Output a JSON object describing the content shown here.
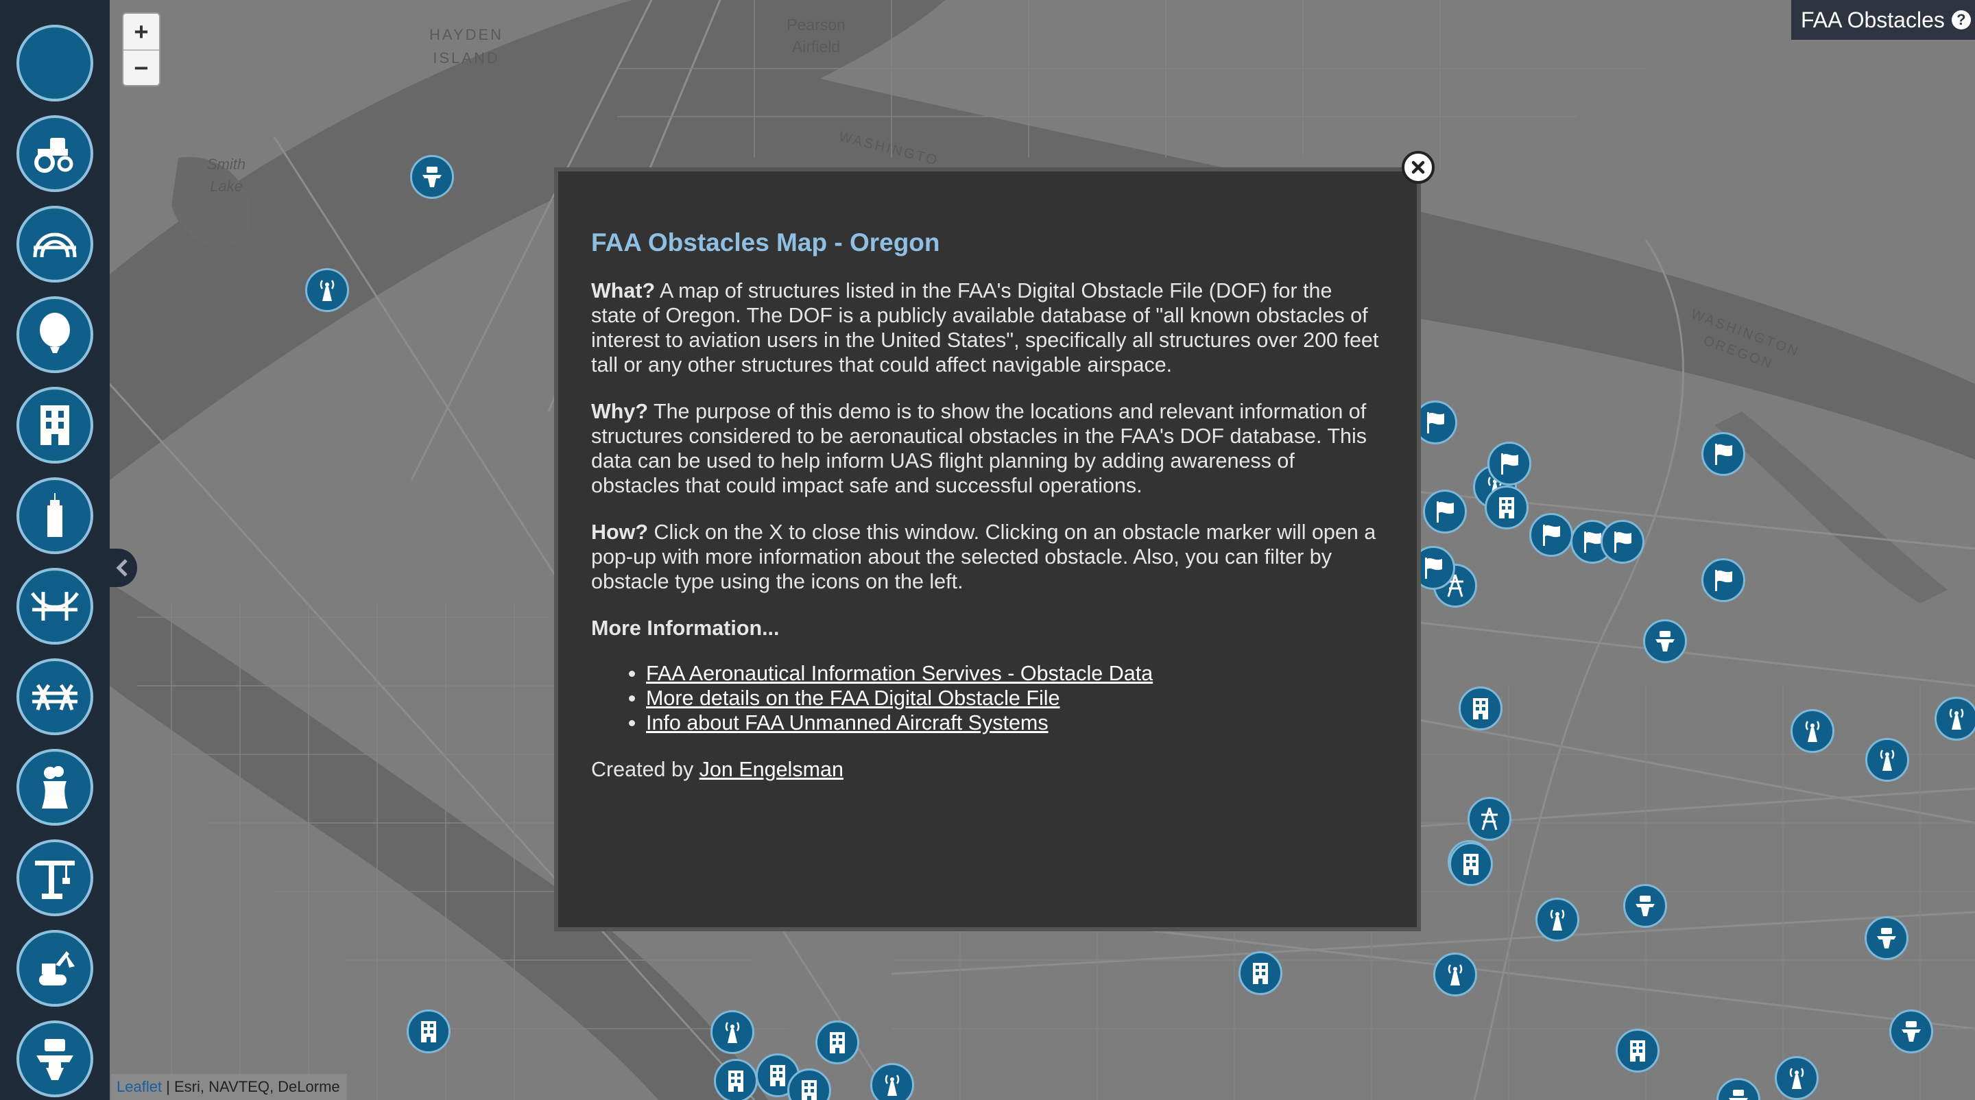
{
  "app": {
    "title": "FAA Obstacles",
    "help_icon": "question-circle-icon"
  },
  "zoom": {
    "in_label": "+",
    "out_label": "−"
  },
  "attribution": {
    "leaflet": "Leaflet",
    "sources": " | Esri, NAVTEQ, DeLorme"
  },
  "map_labels": {
    "hayden": "HAYDEN\nISLAND",
    "pearson": "Pearson\nAirfield",
    "smith": "Smith\nLake",
    "washington_road": "WASHINGTO",
    "state_line": "WASHINGTON\nOREGON"
  },
  "sidebar": {
    "filters": [
      {
        "name": "all-filter",
        "icon": "circle-icon"
      },
      {
        "name": "ag-filter",
        "icon": "tractor-icon"
      },
      {
        "name": "arch-filter",
        "icon": "arch-icon"
      },
      {
        "name": "balloon-filter",
        "icon": "balloon-icon"
      },
      {
        "name": "building-filter",
        "icon": "building-icon"
      },
      {
        "name": "tall-building-filter",
        "icon": "tall-building-icon"
      },
      {
        "name": "bridge-filter",
        "icon": "bridge-icon"
      },
      {
        "name": "catenary-filter",
        "icon": "catenary-icon"
      },
      {
        "name": "cooling-tower-filter",
        "icon": "cooling-tower-icon"
      },
      {
        "name": "crane-filter",
        "icon": "crane-icon"
      },
      {
        "name": "construction-filter",
        "icon": "construction-equipment-icon"
      },
      {
        "name": "water-tower-filter",
        "icon": "water-tower-icon"
      }
    ],
    "collapse_icon": "chevron-left-icon"
  },
  "modal": {
    "title": "FAA Obstacles Map - Oregon",
    "what_label": "What?",
    "what_text": " A map of structures listed in the FAA's Digital Obstacle File (DOF) for the state of Oregon. The DOF is a publicly available database of \"all known obstacles of interest to aviation users in the United States\", specifically all structures over 200 feet tall or any other structures that could affect navigable airspace.",
    "why_label": "Why?",
    "why_text": " The purpose of this demo is to show the locations and relevant information of structures considered to be aeronautical obstacles in the FAA's DOF database. This data can be used to help inform UAS flight planning by adding awareness of obstacles that could impact safe and successful operations.",
    "how_label": "How?",
    "how_text": " Click on the X to close this window. Clicking on an obstacle marker will open a pop-up with more information about the selected obstacle. Also, you can filter by obstacle type using the icons on the left.",
    "more_label": "More Information...",
    "links": [
      "FAA Aeronautical Information Servives - Obstacle Data",
      "More details on the FAA Digital Obstacle File",
      "Info about FAA Unmanned Aircraft Systems"
    ],
    "created_by": "Created by ",
    "author": "Jon Engelsman",
    "close_icon": "close-icon"
  },
  "markers": [
    {
      "type": "water-tower"
    },
    {
      "type": "antenna"
    },
    {
      "type": "flag"
    },
    {
      "type": "flag"
    },
    {
      "type": "flag"
    },
    {
      "type": "antenna"
    },
    {
      "type": "flag"
    },
    {
      "type": "building"
    },
    {
      "type": "flag"
    },
    {
      "type": "flag"
    },
    {
      "type": "flag"
    },
    {
      "type": "flag"
    },
    {
      "type": "catenary"
    },
    {
      "type": "flag"
    },
    {
      "type": "water-tower"
    },
    {
      "type": "building"
    },
    {
      "type": "antenna"
    },
    {
      "type": "antenna"
    },
    {
      "type": "antenna"
    },
    {
      "type": "catenary"
    },
    {
      "type": "building"
    },
    {
      "type": "building"
    },
    {
      "type": "antenna"
    },
    {
      "type": "water-tower"
    },
    {
      "type": "water-tower"
    },
    {
      "type": "building"
    },
    {
      "type": "antenna"
    },
    {
      "type": "building"
    },
    {
      "type": "building"
    },
    {
      "type": "antenna"
    },
    {
      "type": "antenna"
    },
    {
      "type": "building"
    },
    {
      "type": "water-tower"
    },
    {
      "type": "building"
    },
    {
      "type": "building"
    },
    {
      "type": "antenna"
    },
    {
      "type": "water-tower"
    },
    {
      "type": "building"
    }
  ]
}
